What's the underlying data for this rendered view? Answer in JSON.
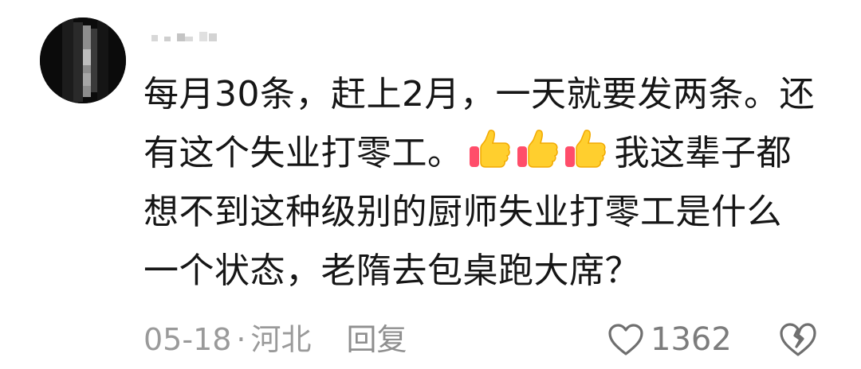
{
  "comment": {
    "username": "",
    "lines": [
      "每月30条，赶上2月，一天就要发两条。还",
      "有这个失业打零工。",
      "我这辈子都",
      "想不到这种级别的厨师失业打零工是什么",
      "一个状态，老隋去包桌跑大席？"
    ],
    "emoji": [
      "thumbs-up-icon",
      "thumbs-up-icon",
      "thumbs-up-icon"
    ],
    "date": "05-18",
    "separator": "·",
    "location": "河北",
    "reply_label": "回复",
    "like_count": "1362"
  }
}
